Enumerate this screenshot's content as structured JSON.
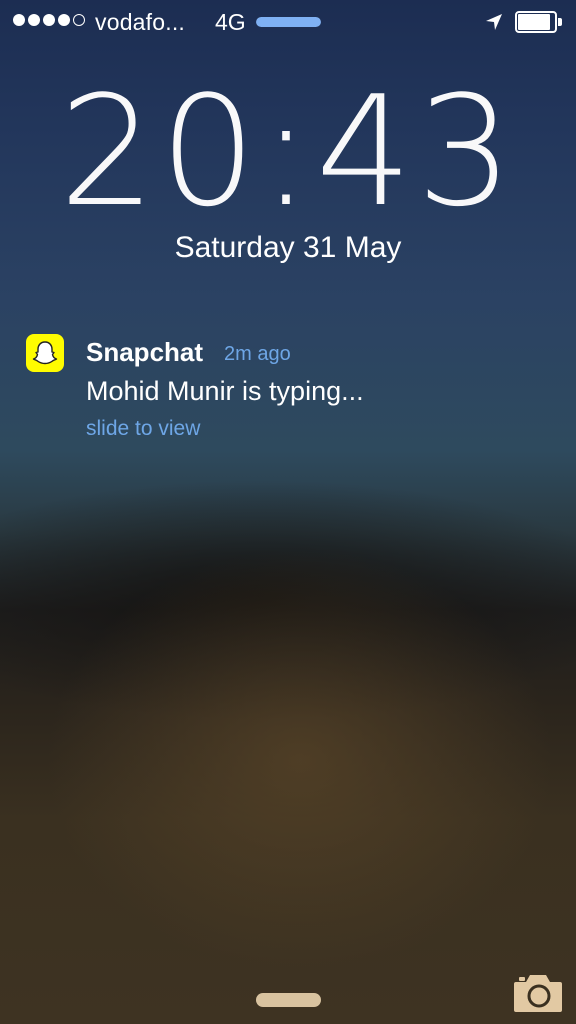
{
  "status_bar": {
    "signal_bars_filled": 4,
    "signal_bars_total": 5,
    "carrier": "vodafo...",
    "network": "4G",
    "progress_fraction": 1.0,
    "battery_fraction": 0.9,
    "icons": [
      "location-arrow-icon",
      "battery-icon"
    ]
  },
  "lock": {
    "time": "20:43",
    "date": "Saturday 31 May"
  },
  "notification": {
    "app_name": "Snapchat",
    "time_ago": "2m ago",
    "message": "Mohid Munir is typing...",
    "action": "slide to view",
    "icon": "snapchat-ghost-icon",
    "icon_color": "#fffc00"
  },
  "colors": {
    "accent": "#6ea6e6",
    "progress": "#7fb1f4",
    "grabber": "#d9c3a0",
    "camera": "#e2c9a3"
  },
  "bottom": {
    "icons": [
      "home-grabber",
      "camera-icon"
    ]
  }
}
